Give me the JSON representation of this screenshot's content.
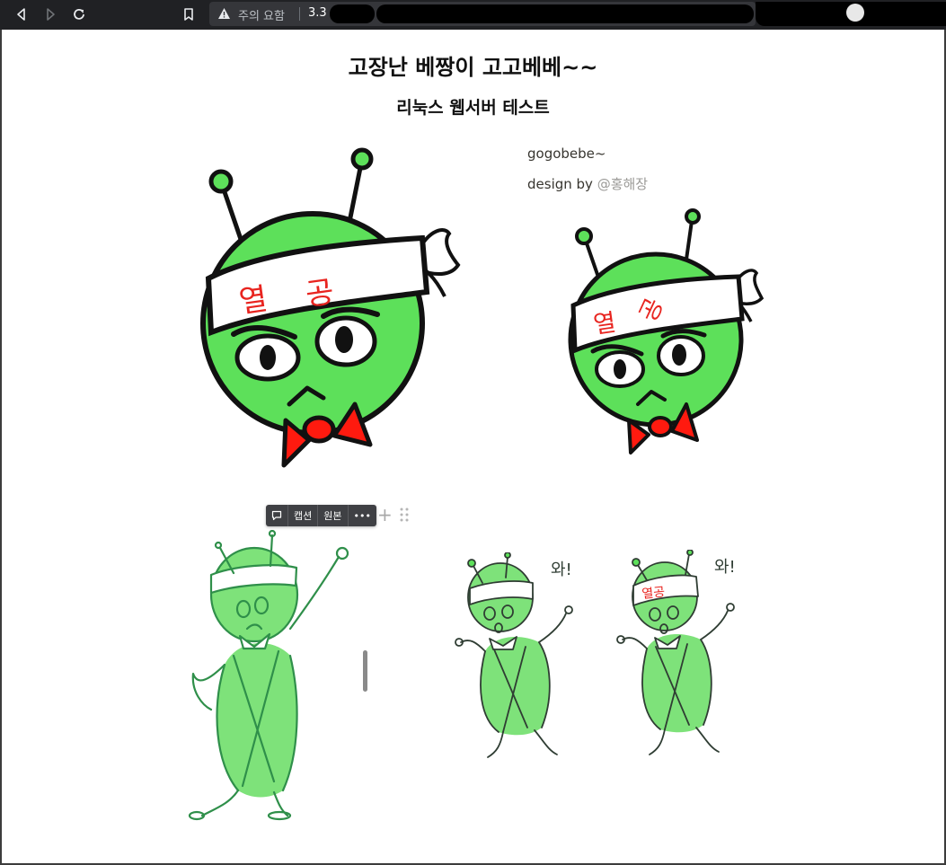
{
  "browser": {
    "security_label": "주의 요함",
    "url_prefix": "3.3",
    "icons": [
      "back-icon",
      "forward-icon",
      "reload-icon",
      "bookmark-icon",
      "warning-icon"
    ]
  },
  "page": {
    "title": "고장난 베짱이 고고베베~~",
    "subtitle": "리눅스 웹서버 테스트",
    "credit_line1": "gogobebe~",
    "credit_prefix": "design by ",
    "credit_mention": "@홍해장",
    "headband_text": "열 공",
    "headband_syllable_1": "열",
    "headband_syllable_2": "공",
    "wow_text": "와!",
    "headband_small_text": "열공"
  },
  "block_menu": {
    "caption_label": "캡션",
    "original_label": "원본",
    "more_label": "•••",
    "plus_label": "+"
  },
  "colors": {
    "bug_green": "#5de05a",
    "bug_light_green": "#7ee27a",
    "bow_red": "#ff1a0f",
    "headband_text_red": "#e8241f",
    "outline": "#111111"
  }
}
